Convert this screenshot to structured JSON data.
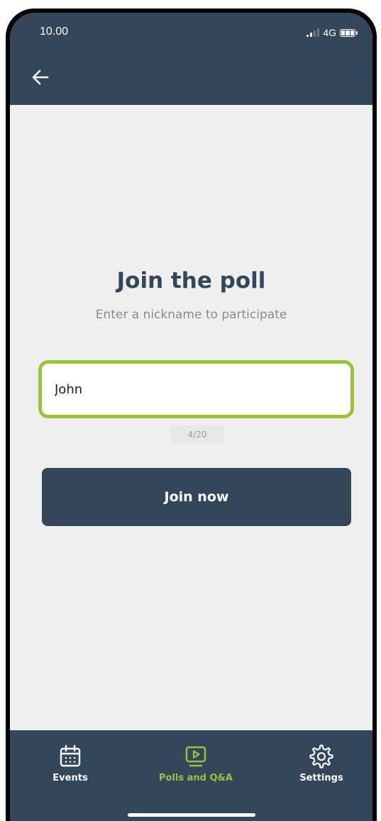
{
  "status_bar": {
    "time": "10.00",
    "network": "4G"
  },
  "header": {
    "back_icon": "arrow-left-icon"
  },
  "join": {
    "title": "Join the poll",
    "subtitle": "Enter a nickname to participate",
    "nickname_value": "John",
    "counter": "4/20",
    "button_label": "Join now"
  },
  "tabbar": {
    "items": [
      {
        "label": "Events",
        "icon": "calendar-icon",
        "active": false
      },
      {
        "label": "Polls and Q&A",
        "icon": "presentation-play-icon",
        "active": true
      },
      {
        "label": "Settings",
        "icon": "gear-icon",
        "active": false
      }
    ]
  },
  "colors": {
    "primary": "#33475b",
    "accent": "#9ac33c",
    "background": "#efefef"
  }
}
